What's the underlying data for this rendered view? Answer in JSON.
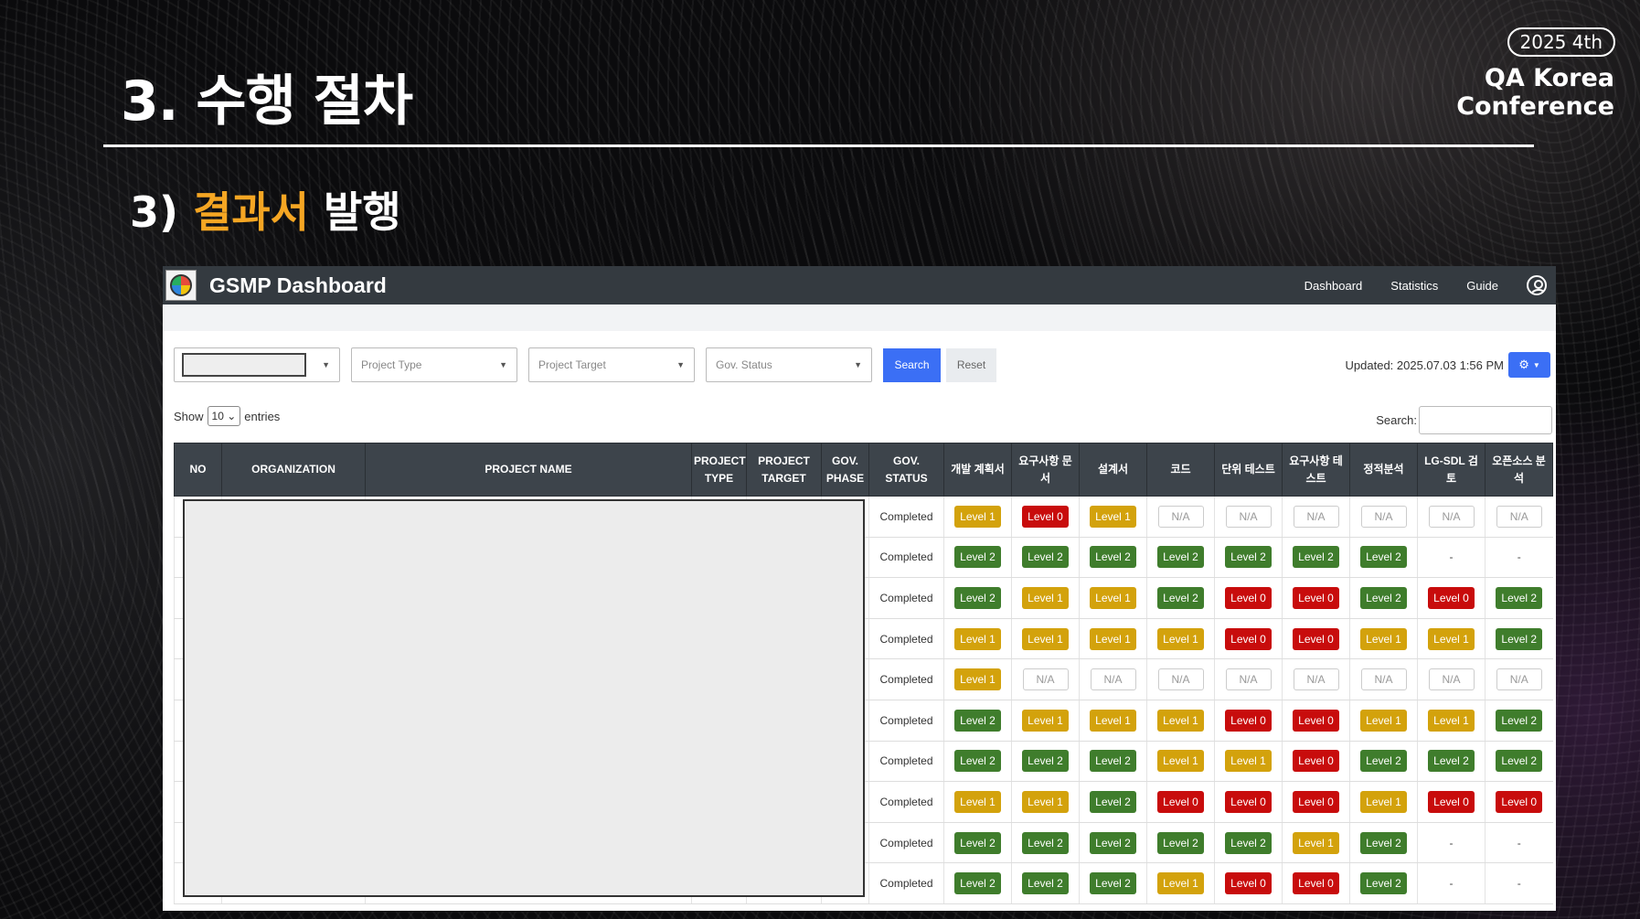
{
  "slide": {
    "title": "3. 수행 절차",
    "subtitle_prefix": "3)",
    "subtitle_accent": "결과서",
    "subtitle_suffix": "발행",
    "conf_badge": "2025 4th",
    "conf_line1": "QA Korea",
    "conf_line2": "Conference",
    "accent_color": "#f5a623"
  },
  "app": {
    "title": "GSMP Dashboard",
    "nav": [
      "Dashboard",
      "Statistics",
      "Guide"
    ],
    "icons": {
      "logo": "pie-chart-logo",
      "user": "user-circle-icon",
      "gear": "gear-icon"
    }
  },
  "filters": {
    "project_type": "Project Type",
    "project_target": "Project Target",
    "gov_status": "Gov. Status",
    "search_label": "Search",
    "reset_label": "Reset",
    "updated": "Updated: 2025.07.03 1:56 PM"
  },
  "length": {
    "show": "Show",
    "value": "10",
    "entries": "entries"
  },
  "search": {
    "label": "Search:"
  },
  "table": {
    "headers": [
      "NO",
      "ORGANIZATION",
      "PROJECT NAME",
      "PROJECT TYPE",
      "PROJECT TARGET",
      "GOV. PHASE",
      "GOV. STATUS",
      "개발 계획서",
      "요구사항 문서",
      "설계서",
      "코드",
      "단위 테스트",
      "요구사항 테스트",
      "정적분석",
      "LG-SDL 검토",
      "오픈소스 분석"
    ],
    "rows": [
      {
        "status": "Completed",
        "cells": [
          "Level 1",
          "Level 0",
          "Level 1",
          "N/A",
          "N/A",
          "N/A",
          "N/A",
          "N/A",
          "N/A"
        ]
      },
      {
        "status": "Completed",
        "cells": [
          "Level 2",
          "Level 2",
          "Level 2",
          "Level 2",
          "Level 2",
          "Level 2",
          "Level 2",
          "-",
          "-"
        ]
      },
      {
        "status": "Completed",
        "cells": [
          "Level 2",
          "Level 1",
          "Level 1",
          "Level 2",
          "Level 0",
          "Level 0",
          "Level 2",
          "Level 0",
          "Level 2"
        ]
      },
      {
        "status": "Completed",
        "cells": [
          "Level 1",
          "Level 1",
          "Level 1",
          "Level 1",
          "Level 0",
          "Level 0",
          "Level 1",
          "Level 1",
          "Level 2"
        ]
      },
      {
        "status": "Completed",
        "cells": [
          "Level 1",
          "N/A",
          "N/A",
          "N/A",
          "N/A",
          "N/A",
          "N/A",
          "N/A",
          "N/A"
        ]
      },
      {
        "status": "Completed",
        "cells": [
          "Level 2",
          "Level 1",
          "Level 1",
          "Level 1",
          "Level 0",
          "Level 0",
          "Level 1",
          "Level 1",
          "Level 2"
        ]
      },
      {
        "status": "Completed",
        "cells": [
          "Level 2",
          "Level 2",
          "Level 2",
          "Level 1",
          "Level 1",
          "Level 0",
          "Level 2",
          "Level 2",
          "Level 2"
        ]
      },
      {
        "status": "Completed",
        "cells": [
          "Level 1",
          "Level 1",
          "Level 2",
          "Level 0",
          "Level 0",
          "Level 0",
          "Level 1",
          "Level 0",
          "Level 0"
        ]
      },
      {
        "status": "Completed",
        "cells": [
          "Level 2",
          "Level 2",
          "Level 2",
          "Level 2",
          "Level 2",
          "Level 1",
          "Level 2",
          "-",
          "-"
        ]
      },
      {
        "status": "Completed",
        "cells": [
          "Level 2",
          "Level 2",
          "Level 2",
          "Level 1",
          "Level 0",
          "Level 0",
          "Level 2",
          "-",
          "-"
        ]
      }
    ]
  },
  "level_colors": {
    "Level 0": "#c80c0c",
    "Level 1": "#d3a20c",
    "Level 2": "#3f7d2c"
  }
}
